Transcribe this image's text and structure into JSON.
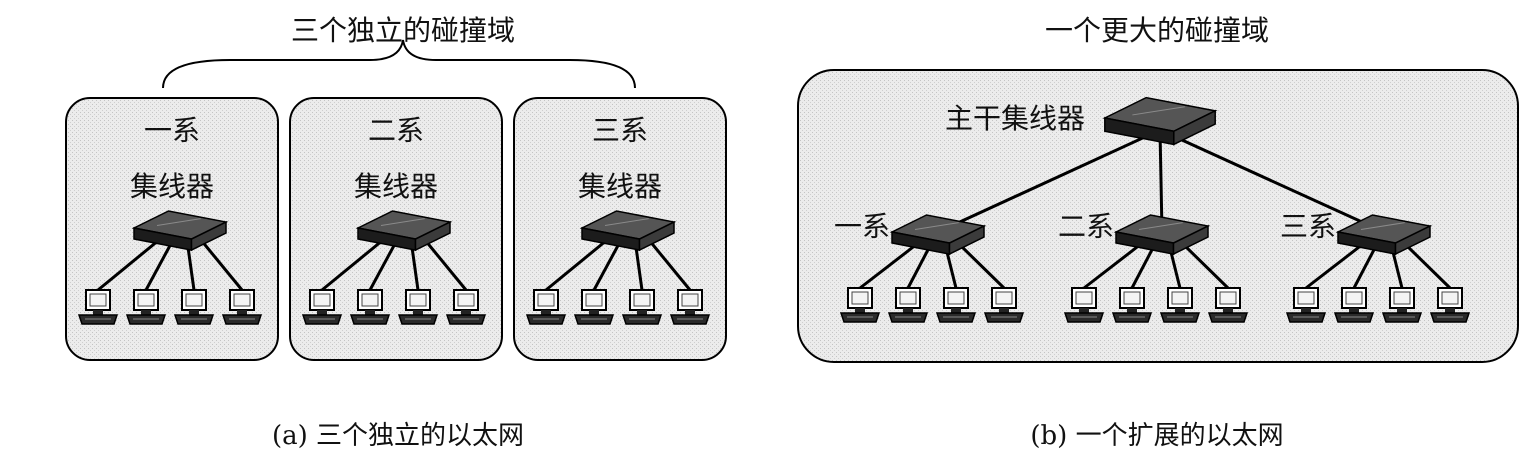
{
  "panel_a": {
    "top_label": "三个独立的碰撞域",
    "caption": "(a) 三个独立的以太网",
    "domains": [
      {
        "dept": "一系",
        "hub": "集线器",
        "pcs": 4
      },
      {
        "dept": "二系",
        "hub": "集线器",
        "pcs": 4
      },
      {
        "dept": "三系",
        "hub": "集线器",
        "pcs": 4
      }
    ]
  },
  "panel_b": {
    "top_label": "一个更大的碰撞域",
    "caption": "(b) 一个扩展的以太网",
    "backbone": "主干集线器",
    "hubs": [
      {
        "dept": "一系",
        "pcs": 4
      },
      {
        "dept": "二系",
        "pcs": 4
      },
      {
        "dept": "三系",
        "pcs": 4
      }
    ]
  },
  "colors": {
    "domain_fill": "#e9e9e9",
    "hub_fill": "#3b3b3b",
    "line": "#000000"
  },
  "icons": {
    "hub": "hub-icon",
    "pc": "computer-icon"
  }
}
